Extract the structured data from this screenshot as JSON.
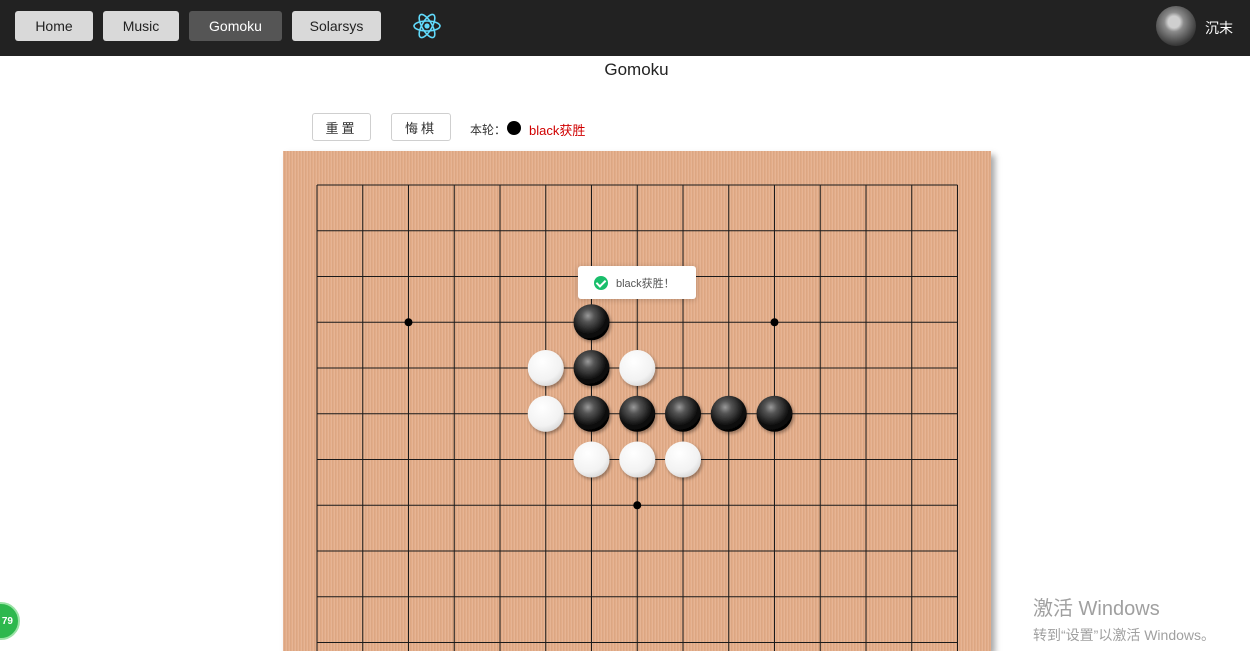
{
  "nav": {
    "items": [
      {
        "label": "Home",
        "active": false
      },
      {
        "label": "Music",
        "active": false
      },
      {
        "label": "Gomoku",
        "active": true
      },
      {
        "label": "Solarsys",
        "active": false
      }
    ],
    "logo_icon": "react-atom-icon",
    "logo_color": "#61dafb",
    "username": "沉末"
  },
  "page": {
    "title": "Gomoku"
  },
  "controls": {
    "reset_label": "重置",
    "undo_label": "悔棋",
    "turn_label": "本轮：",
    "turn_stone": "black",
    "result_text": "black获胜",
    "result_color": "#d00000"
  },
  "board": {
    "grid_size": 15,
    "visible_rows": 11,
    "star_points": [
      [
        2,
        3
      ],
      [
        10,
        3
      ],
      [
        7,
        7
      ]
    ],
    "stones": [
      {
        "col": 6,
        "row": 3,
        "color": "black"
      },
      {
        "col": 5,
        "row": 4,
        "color": "white"
      },
      {
        "col": 6,
        "row": 4,
        "color": "black"
      },
      {
        "col": 7,
        "row": 4,
        "color": "white"
      },
      {
        "col": 5,
        "row": 5,
        "color": "white"
      },
      {
        "col": 6,
        "row": 5,
        "color": "black"
      },
      {
        "col": 7,
        "row": 5,
        "color": "black"
      },
      {
        "col": 8,
        "row": 5,
        "color": "black"
      },
      {
        "col": 9,
        "row": 5,
        "color": "black"
      },
      {
        "col": 10,
        "row": 5,
        "color": "black"
      },
      {
        "col": 6,
        "row": 6,
        "color": "white"
      },
      {
        "col": 7,
        "row": 6,
        "color": "white"
      },
      {
        "col": 8,
        "row": 6,
        "color": "white"
      }
    ]
  },
  "toast": {
    "icon": "check-circle-icon",
    "text": "black获胜！"
  },
  "watermark": {
    "title": "激活 Windows",
    "subtitle": "转到“设置”以激活 Windows。"
  },
  "float_ball": {
    "text": "79"
  }
}
